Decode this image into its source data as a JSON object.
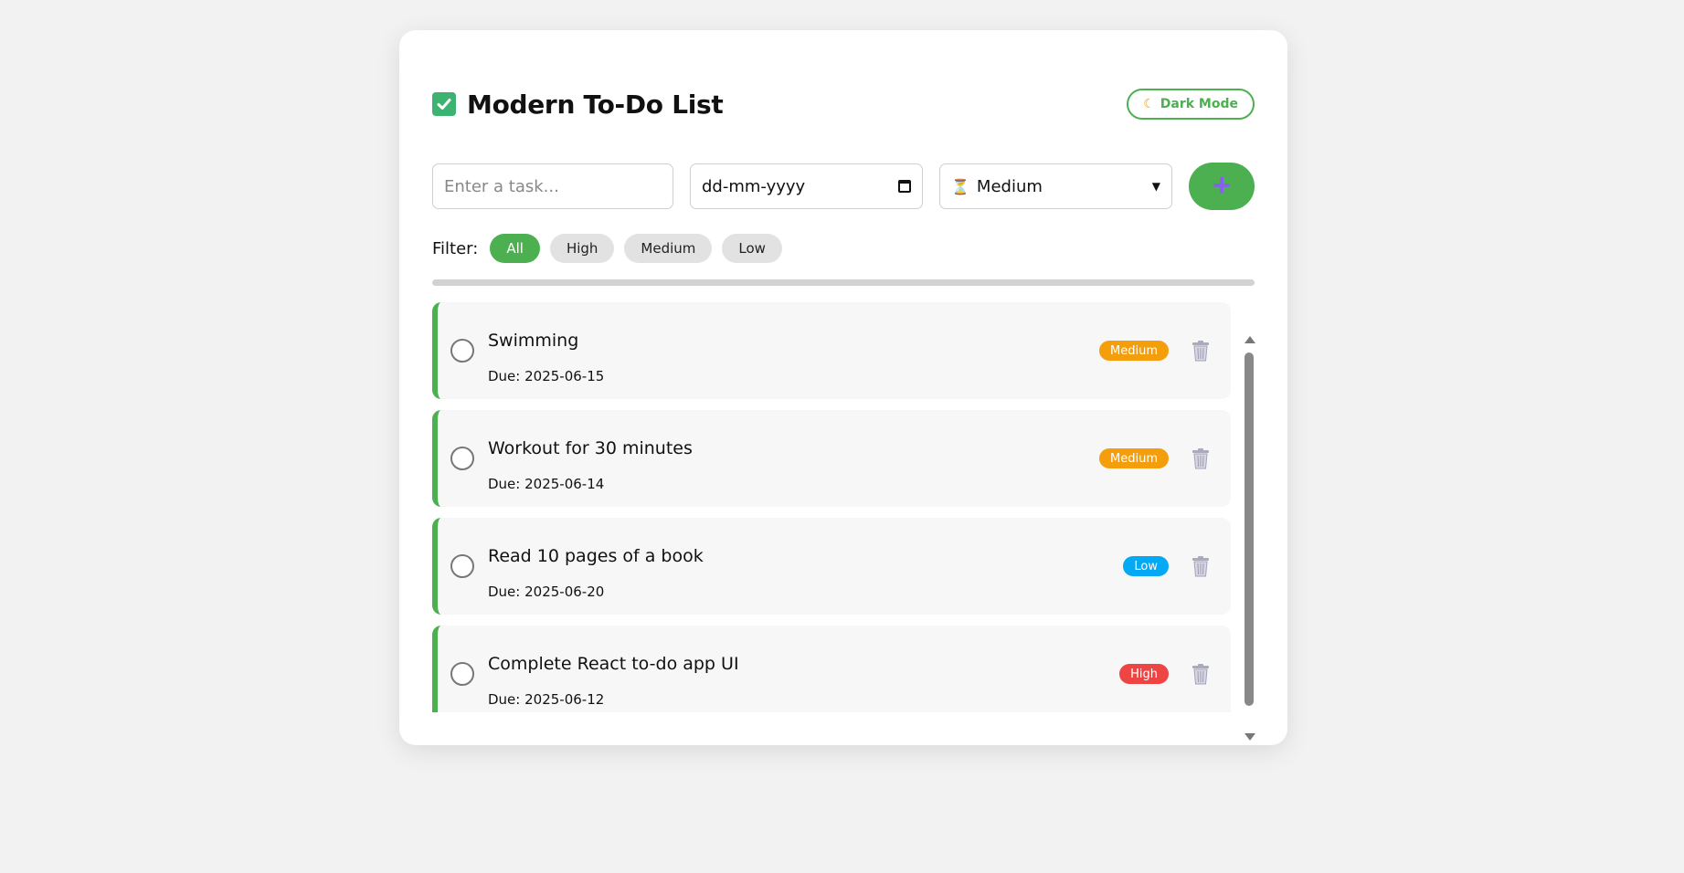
{
  "header": {
    "title": "Modern To-Do List",
    "title_icon": "check-box-icon",
    "dark_mode_label": "Dark Mode",
    "dark_mode_icon": "moon-icon"
  },
  "form": {
    "task_placeholder": "Enter a task...",
    "task_value": "",
    "date_placeholder": "dd-mm-yyyy",
    "priority_icon": "hourglass-icon",
    "priority_selected": "Medium",
    "add_icon": "plus-icon"
  },
  "filter": {
    "label": "Filter:",
    "options": [
      "All",
      "High",
      "Medium",
      "Low"
    ],
    "active": "All"
  },
  "tasks": [
    {
      "title": "Swimming",
      "due": "Due: 2025-06-15",
      "priority": "Medium"
    },
    {
      "title": "Workout for 30 minutes",
      "due": "Due: 2025-06-14",
      "priority": "Medium"
    },
    {
      "title": "Read 10 pages of a book",
      "due": "Due: 2025-06-20",
      "priority": "Low"
    },
    {
      "title": "Complete React to-do app UI",
      "due": "Due: 2025-06-12",
      "priority": "High"
    }
  ],
  "colors": {
    "accent": "#4caf50",
    "medium": "#f59e0b",
    "low": "#03a9f4",
    "high": "#ef4444",
    "plus": "#8a5cf6"
  }
}
